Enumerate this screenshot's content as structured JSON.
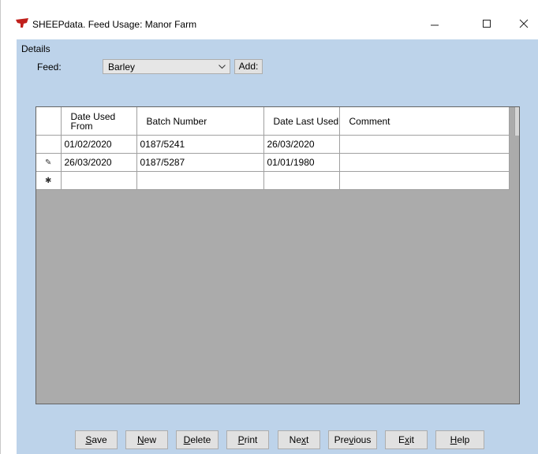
{
  "window": {
    "title": "SHEEPdata. Feed Usage: Manor Farm",
    "icon": "sheepdata-app-icon",
    "minimize_glyph": "—",
    "close_glyph": "✕"
  },
  "details": {
    "group_label": "Details",
    "feed_label": "Feed:",
    "feed_value": "Barley",
    "add_label": "Add:"
  },
  "grid": {
    "columns": [
      "Date Used From",
      "Batch Number",
      "Date Last Used",
      "Comment"
    ],
    "rows": [
      {
        "indicator": "",
        "date_from": "01/02/2020",
        "batch": "0187/5241",
        "date_last": "26/03/2020",
        "comment": ""
      },
      {
        "indicator": "✎",
        "date_from": "26/03/2020",
        "batch": "0187/5287",
        "date_last": "01/01/1980",
        "comment": ""
      },
      {
        "indicator": "✱",
        "date_from": "",
        "batch": "",
        "date_last": "",
        "comment": ""
      }
    ]
  },
  "buttons": [
    {
      "pre": "",
      "key": "S",
      "post": "ave"
    },
    {
      "pre": "",
      "key": "N",
      "post": "ew"
    },
    {
      "pre": "",
      "key": "D",
      "post": "elete"
    },
    {
      "pre": "",
      "key": "P",
      "post": "rint"
    },
    {
      "pre": "Ne",
      "key": "x",
      "post": "t"
    },
    {
      "pre": "Pre",
      "key": "v",
      "post": "ious"
    },
    {
      "pre": "E",
      "key": "x",
      "post": "it"
    },
    {
      "pre": "",
      "key": "H",
      "post": "elp"
    }
  ],
  "colors": {
    "client_background": "#bdd3ea",
    "grid_empty_area": "#ababab",
    "icon_red": "#c0201c"
  }
}
